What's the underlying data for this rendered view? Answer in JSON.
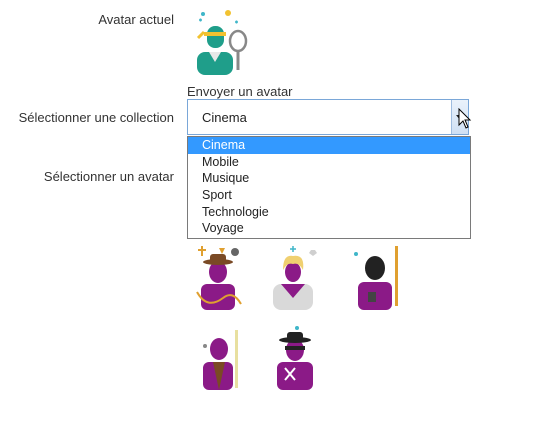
{
  "labels": {
    "current_avatar": "Avatar actuel",
    "select_collection": "Sélectionner une collection",
    "select_avatar": "Sélectionner un avatar"
  },
  "upload_link": "Envoyer un avatar",
  "select": {
    "value": "Cinema",
    "options": [
      {
        "label": "Cinema",
        "selected": true
      },
      {
        "label": "Mobile",
        "selected": false
      },
      {
        "label": "Musique",
        "selected": false
      },
      {
        "label": "Sport",
        "selected": false
      },
      {
        "label": "Technologie",
        "selected": false
      },
      {
        "label": "Voyage",
        "selected": false
      }
    ]
  },
  "colors": {
    "accent_selected": "#3399ff",
    "avatar_body": "#8b1a87",
    "avatar_current": "#1f9e8a",
    "sparkle": "#3fb6c9"
  },
  "avatars": {
    "current": "tennis-player-avatar-icon",
    "grid": [
      "adventurer-hat-whip-avatar-icon",
      "blonde-actress-avatar-icon",
      "masked-villain-saber-avatar-icon",
      "jedi-saber-avatar-icon",
      "zorro-masked-avatar-icon"
    ]
  }
}
